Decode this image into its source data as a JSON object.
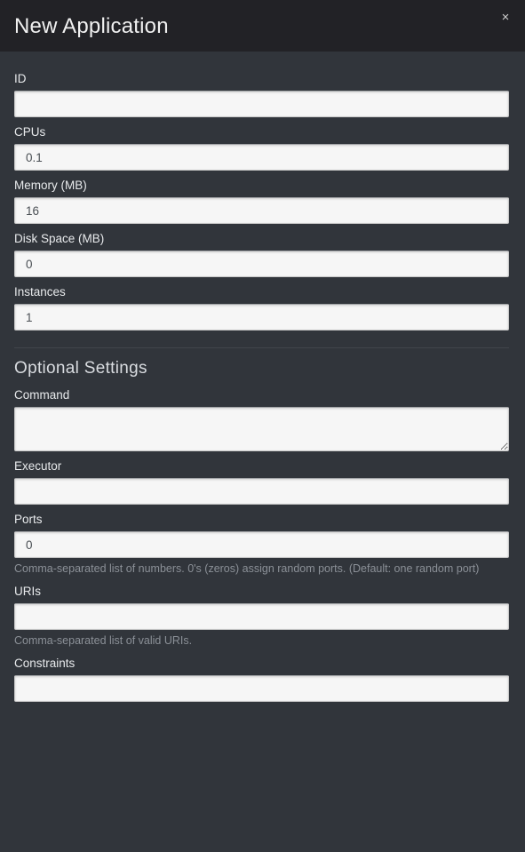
{
  "header": {
    "title": "New Application",
    "close_label": "×"
  },
  "form": {
    "fields": [
      {
        "label": "ID",
        "value": "",
        "placeholder": "",
        "type": "text"
      },
      {
        "label": "CPUs",
        "value": "0.1",
        "placeholder": "",
        "type": "text"
      },
      {
        "label": "Memory (MB)",
        "value": "16",
        "placeholder": "",
        "type": "text"
      },
      {
        "label": "Disk Space (MB)",
        "value": "0",
        "placeholder": "",
        "type": "text"
      },
      {
        "label": "Instances",
        "value": "1",
        "placeholder": "",
        "type": "text"
      }
    ]
  },
  "optional": {
    "heading": "Optional Settings",
    "fields": [
      {
        "label": "Command",
        "value": "",
        "placeholder": "",
        "type": "textarea",
        "help": ""
      },
      {
        "label": "Executor",
        "value": "",
        "placeholder": "",
        "type": "text",
        "help": ""
      },
      {
        "label": "Ports",
        "value": "0",
        "placeholder": "",
        "type": "text",
        "help": "Comma-separated list of numbers. 0's (zeros) assign random ports. (Default: one random port)"
      },
      {
        "label": "URIs",
        "value": "",
        "placeholder": "",
        "type": "text",
        "help": "Comma-separated list of valid URIs."
      },
      {
        "label": "Constraints",
        "value": "",
        "placeholder": "",
        "type": "text",
        "help": ""
      }
    ]
  },
  "colors": {
    "header_bg": "#222226",
    "body_bg": "#31353b",
    "input_bg": "#f6f6f6",
    "label_text": "#e8eaec",
    "help_text": "#8b9097",
    "divider": "#41454b"
  }
}
